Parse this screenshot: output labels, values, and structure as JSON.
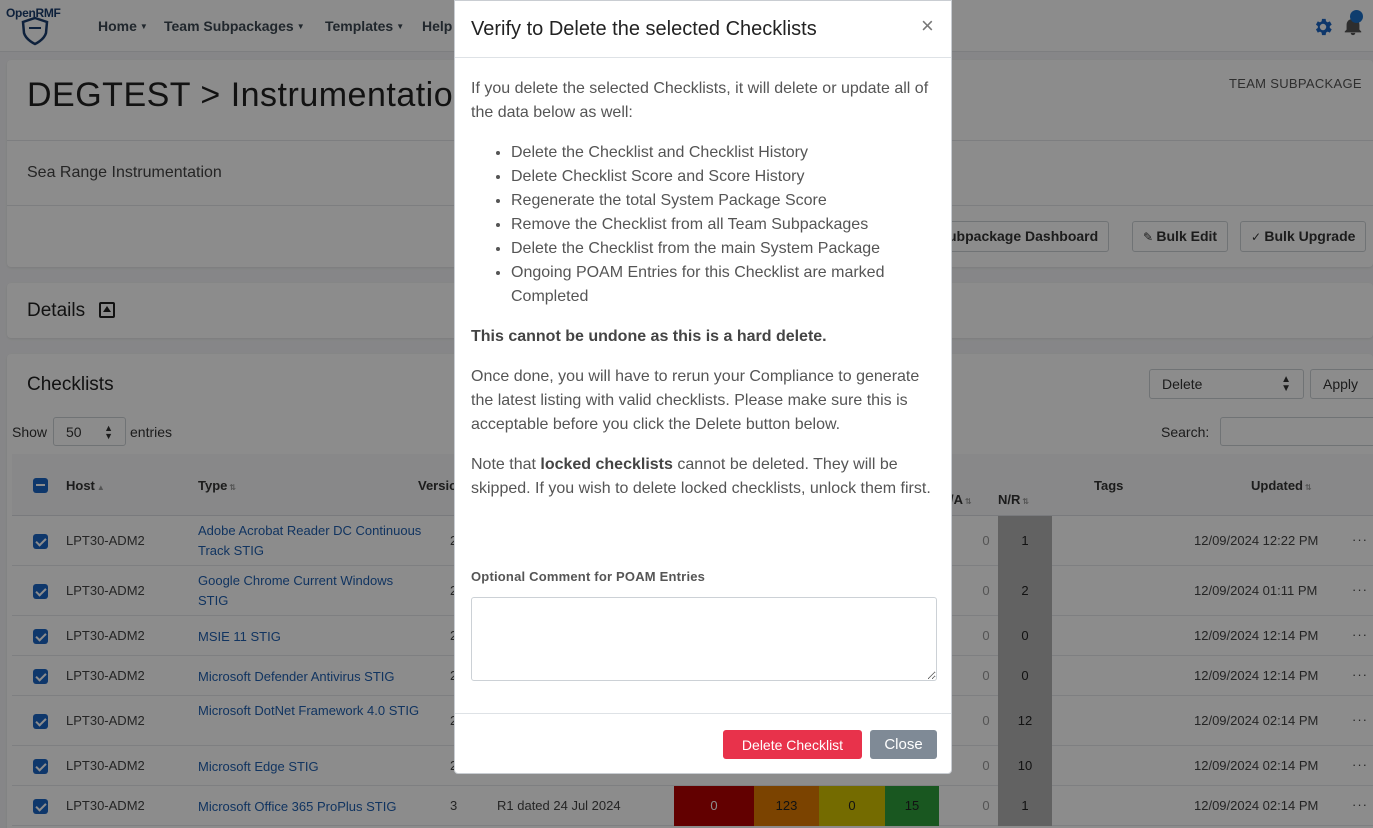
{
  "nav": {
    "logo": "OpenRMF",
    "items": [
      {
        "label": "Home"
      },
      {
        "label": "Team Subpackages"
      },
      {
        "label": "Templates"
      },
      {
        "label": "Help"
      }
    ],
    "icons": [
      "gear-icon",
      "bell-icon"
    ]
  },
  "header": {
    "title": "DEGTEST > Instrumentatio",
    "team_subpackage_label": "TEAM SUBPACKAGE",
    "description": "Sea Range Instrumentation",
    "buttons": {
      "dashboard": "ubpackage Dashboard",
      "bulk_edit": "Bulk Edit",
      "bulk_upgrade": "Bulk Upgrade"
    }
  },
  "details": {
    "title": "Details"
  },
  "checklists": {
    "title": "Checklists",
    "bulk_action": "Delete",
    "apply": "Apply",
    "show": "Show",
    "page_size": "50",
    "entries": "entries",
    "search": "Search:",
    "columns": {
      "host": "Host",
      "type": "Type",
      "version": "Versio",
      "na": "/A",
      "nr": "N/R",
      "tags": "Tags",
      "updated": "Updated"
    },
    "rows": [
      {
        "host": "LPT30-ADM2",
        "type": "Adobe Acrobat Reader DC Continuous Track STIG",
        "version": "2",
        "na": "0",
        "nr": "1",
        "updated": "12/09/2024 12:22 PM"
      },
      {
        "host": "LPT30-ADM2",
        "type": "Google Chrome Current Windows STIG",
        "version": "2",
        "na": "0",
        "nr": "2",
        "updated": "12/09/2024 01:11 PM"
      },
      {
        "host": "LPT30-ADM2",
        "type": "MSIE 11 STIG",
        "version": "2",
        "na": "0",
        "nr": "0",
        "updated": "12/09/2024 12:14 PM"
      },
      {
        "host": "LPT30-ADM2",
        "type": "Microsoft Defender Antivirus STIG",
        "version": "2",
        "na": "0",
        "nr": "0",
        "updated": "12/09/2024 12:14 PM"
      },
      {
        "host": "LPT30-ADM2",
        "type": "Microsoft DotNet Framework 4.0 STIG",
        "version": "2",
        "na": "0",
        "nr": "12",
        "updated": "12/09/2024 02:14 PM"
      },
      {
        "host": "LPT30-ADM2",
        "type": "Microsoft Edge STIG",
        "version": "2",
        "na": "0",
        "nr": "10",
        "updated": "12/09/2024 02:14 PM"
      },
      {
        "host": "LPT30-ADM2",
        "type": "Microsoft Office 365 ProPlus STIG",
        "version": "3",
        "release": "R1 dated 24 Jul 2024",
        "cat1": "0",
        "cat2": "123",
        "cat3": "0",
        "nf": "15",
        "na": "0",
        "nr": "1",
        "updated": "12/09/2024 02:14 PM"
      }
    ],
    "row_menu": "···"
  },
  "modal": {
    "title": "Verify to Delete the selected Checklists",
    "close_icon": "×",
    "intro": "If you delete the selected Checklists, it will delete or update all of the data below as well:",
    "bullets": [
      "Delete the Checklist and Checklist History",
      "Delete Checklist Score and Score History",
      "Regenerate the total System Package Score",
      "Remove the Checklist from all Team Subpackages",
      "Delete the Checklist from the main System Package",
      "Ongoing POAM Entries for this Checklist are marked Completed"
    ],
    "warning": "This cannot be undone as this is a hard delete.",
    "once_done": "Once done, you will have to rerun your Compliance to generate the latest listing with valid checklists. Please make sure this is acceptable before you click the Delete button below.",
    "note_prefix": "Note that ",
    "note_bold": "locked checklists",
    "note_suffix": " cannot be deleted. They will be skipped. If you wish to delete locked checklists, unlock them first.",
    "comment_label": "Optional Comment for POAM Entries",
    "comment_value": "",
    "delete_button": "Delete Checklist",
    "close_button": "Close"
  },
  "colors": {
    "primary": "#1a64c4",
    "danger": "#e8324b",
    "secondary": "#7f8a96",
    "cat1": "#b30000",
    "cat2": "#e07b00",
    "cat3": "#d4c400",
    "nf": "#2e9e3b"
  }
}
